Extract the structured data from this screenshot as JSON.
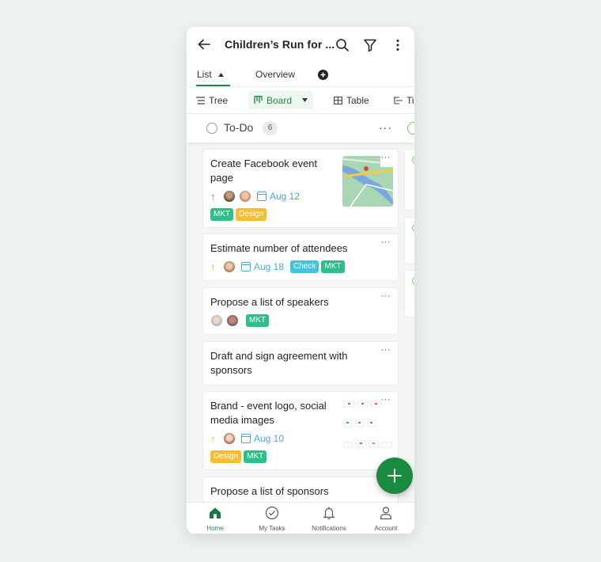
{
  "header": {
    "title": "Children’s Run for ...",
    "icons": [
      "back-arrow-icon",
      "search-icon",
      "filter-icon",
      "more-vertical-icon"
    ]
  },
  "tabs": [
    {
      "label": "List",
      "active": true,
      "icon": "caret-up-icon"
    },
    {
      "label": "Overview",
      "active": false
    },
    {
      "label": "",
      "icon": "add-circle-icon"
    }
  ],
  "views": [
    {
      "label": "Tree",
      "icon": "tree-icon"
    },
    {
      "label": "Board",
      "icon": "board-icon",
      "active": true,
      "dropdown": true
    },
    {
      "label": "Table",
      "icon": "table-icon"
    },
    {
      "label": "Ti",
      "icon": "timeline-icon"
    }
  ],
  "column": {
    "name": "To-Do",
    "count": "6",
    "more": "···"
  },
  "colors": {
    "accent": "#1f8a48",
    "fab": "#1a8a41",
    "mkt": "#2bbf8a",
    "design": "#f7bd2c",
    "check": "#3ec6dc",
    "date": "#4aa8d8",
    "priority_high": "#e8505b",
    "priority_medium": "#f5a623"
  },
  "cards": [
    {
      "title_l1": "Create Facebook event",
      "title_l2": "page",
      "priority": "high",
      "avatars": 2,
      "date": "Aug 12",
      "tags": [
        "MKT",
        "Design"
      ],
      "thumbnail": "map-thumbnail",
      "more": "···"
    },
    {
      "title_l1": "Estimate number of attendees",
      "title_l2": "",
      "priority": "medium",
      "avatars": 1,
      "date": "Aug 18",
      "tags": [
        "Check",
        "MKT"
      ],
      "more": "···"
    },
    {
      "title_l1": "Propose a list of speakers",
      "title_l2": "",
      "priority": "none",
      "avatars": 2,
      "date": "",
      "tags": [
        "MKT"
      ],
      "more": "···"
    },
    {
      "title_l1": "Draft and sign agreement with",
      "title_l2": "sponsors",
      "priority": "none",
      "avatars": 0,
      "date": "",
      "tags": [],
      "more": "···"
    },
    {
      "title_l1": "Brand - event logo, social",
      "title_l2": "media images",
      "priority": "medium",
      "avatars": 1,
      "date": "Aug 10",
      "tags": [
        "Design",
        "MKT"
      ],
      "thumbnail": "design-thumbnail",
      "more": "···"
    },
    {
      "title_l1": "Propose a list of sponsors",
      "title_l2": "",
      "more": "···"
    }
  ],
  "bottom_nav": [
    {
      "label": "Home",
      "icon": "home-icon",
      "active": true
    },
    {
      "label": "My Tasks",
      "icon": "check-circle-icon",
      "active": false
    },
    {
      "label": "Notifications",
      "icon": "bell-icon",
      "active": false
    },
    {
      "label": "Account",
      "icon": "account-icon",
      "active": false
    }
  ]
}
